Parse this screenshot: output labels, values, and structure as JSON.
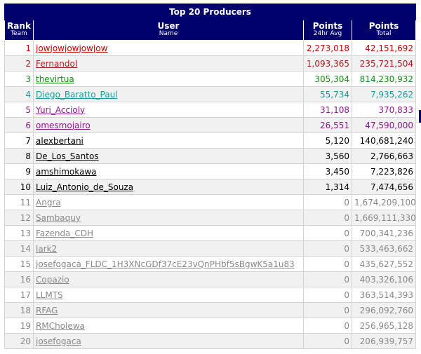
{
  "title": "Top 20 Producers",
  "headers": {
    "rank": "Rank",
    "rank_sub": "Team",
    "user": "User",
    "user_sub": "Name",
    "p24": "Points",
    "p24_sub": "24hr Avg",
    "total": "Points",
    "total_sub": "Total"
  },
  "rows": [
    {
      "rank": "1",
      "name": "jowjowjowjowjow",
      "avg": "2,273,018",
      "total": "42,151,692",
      "color": "#cc0000"
    },
    {
      "rank": "2",
      "name": "Fernandol",
      "avg": "1,093,365",
      "total": "235,721,504",
      "color": "#aa1a1a"
    },
    {
      "rank": "3",
      "name": "thevirtua",
      "avg": "305,304",
      "total": "814,230,932",
      "color": "#168b16"
    },
    {
      "rank": "4",
      "name": "Diego_Baratto_Paul",
      "avg": "55,734",
      "total": "7,935,262",
      "color": "#1a9a9a"
    },
    {
      "rank": "5",
      "name": "Yuri_Accioly",
      "avg": "31,108",
      "total": "370,833",
      "color": "#8a1a8a"
    },
    {
      "rank": "6",
      "name": "omesmojairo",
      "avg": "26,551",
      "total": "47,590,000",
      "color": "#8a1a8a"
    },
    {
      "rank": "7",
      "name": "alexbertani",
      "avg": "5,120",
      "total": "140,681,240",
      "color": "#000000"
    },
    {
      "rank": "8",
      "name": "De_Los_Santos",
      "avg": "3,560",
      "total": "2,766,663",
      "color": "#000000"
    },
    {
      "rank": "9",
      "name": "amshimokawa",
      "avg": "3,450",
      "total": "7,223,826",
      "color": "#000000"
    },
    {
      "rank": "10",
      "name": "Luiz_Antonio_de_Souza",
      "avg": "1,314",
      "total": "7,474,656",
      "color": "#000000"
    },
    {
      "rank": "11",
      "name": "Angra",
      "avg": "0",
      "total": "1,674,209,100",
      "color": "#888888"
    },
    {
      "rank": "12",
      "name": "Sambaquy",
      "avg": "0",
      "total": "1,669,111,330",
      "color": "#888888"
    },
    {
      "rank": "13",
      "name": "Fazenda_CDH",
      "avg": "0",
      "total": "700,341,236",
      "color": "#888888"
    },
    {
      "rank": "14",
      "name": "lark2",
      "avg": "0",
      "total": "533,463,662",
      "color": "#888888"
    },
    {
      "rank": "15",
      "name": "josefogaca_FLDC_1H3XNcGDf37cE23vQnPHbf5sBgwK5a1u83",
      "avg": "0",
      "total": "435,627,552",
      "color": "#888888"
    },
    {
      "rank": "16",
      "name": "Copazio",
      "avg": "0",
      "total": "403,326,106",
      "color": "#888888"
    },
    {
      "rank": "17",
      "name": "LLMTS",
      "avg": "0",
      "total": "363,514,393",
      "color": "#888888"
    },
    {
      "rank": "18",
      "name": "RFAG",
      "avg": "0",
      "total": "296,092,760",
      "color": "#888888"
    },
    {
      "rank": "19",
      "name": "RMCholewa",
      "avg": "0",
      "total": "256,965,128",
      "color": "#888888"
    },
    {
      "rank": "20",
      "name": "josefogaca",
      "avg": "0",
      "total": "206,939,757",
      "color": "#888888"
    }
  ]
}
